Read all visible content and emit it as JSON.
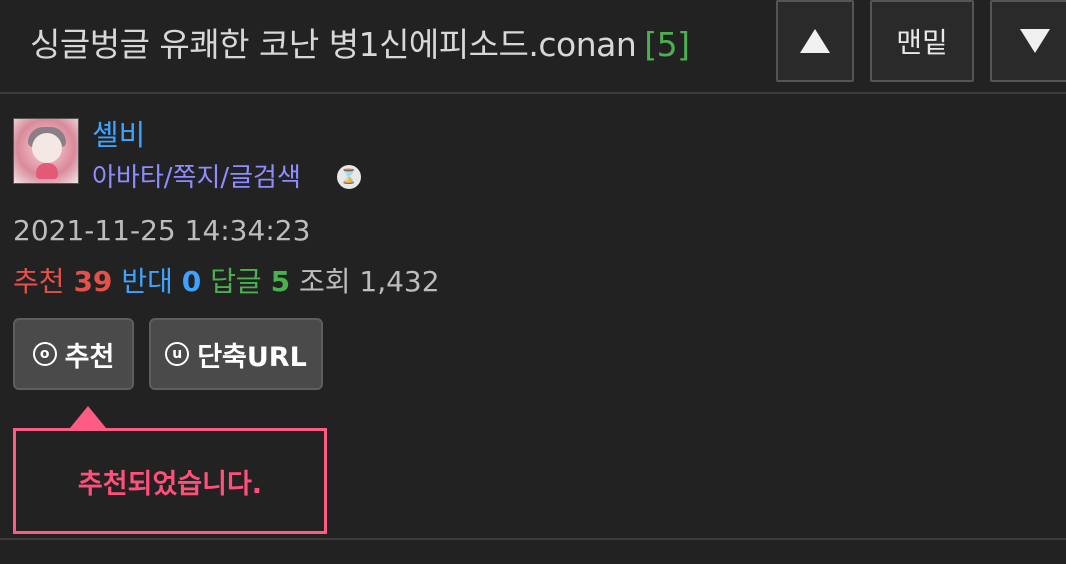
{
  "header": {
    "title": "싱글벙글 유쾌한 코난 병1신에피소드.conan",
    "comment_count": "[5]",
    "scroll_up_icon": "triangle-up-icon",
    "scroll_bottom_label": "맨밑",
    "scroll_down_icon": "triangle-down-icon"
  },
  "author": {
    "nickname": "셸비",
    "links": "아바타/쪽지/글검색",
    "level_icon": "level-badge-icon"
  },
  "post": {
    "date": "2021-11-25 14:34:23",
    "recommend_label": "추천",
    "recommend_value": "39",
    "oppose_label": "반대",
    "oppose_value": "0",
    "reply_label": "답글",
    "reply_value": "5",
    "view_label": "조회",
    "view_value": "1,432"
  },
  "actions": {
    "recommend_icon_glyph": "o",
    "recommend_label": "추천",
    "short_url_icon_glyph": "u",
    "short_url_label": "단축URL"
  },
  "popup": {
    "message": "추천되었습니다."
  },
  "colors": {
    "background": "#222222",
    "link_blue": "#3ea2ff",
    "link_purple": "#8f8cff",
    "red": "#e4504a",
    "green": "#4caf50",
    "popup_pink": "#ff5b84"
  }
}
